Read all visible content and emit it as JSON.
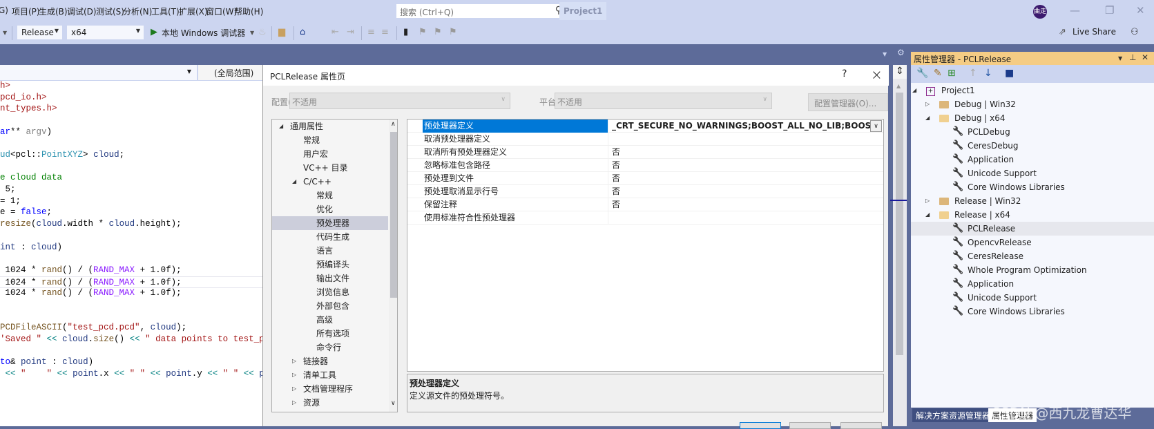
{
  "menubar": {
    "items": [
      "G)",
      "项目(P)",
      "生成(B)",
      "调试(D)",
      "测试(S)",
      "分析(N)",
      "工具(T)",
      "扩展(X)",
      "窗口(W)",
      "帮助(H)"
    ],
    "search_placeholder": "搜索 (Ctrl+Q)",
    "project_name": "Project1",
    "avatar_initials": "曲走"
  },
  "toolbar": {
    "configuration": "Release",
    "platform": "x64",
    "run_label": "本地 Windows 调试器",
    "live_share": "Live Share"
  },
  "editor": {
    "scope": "(全局范围)",
    "lines": [
      [
        [
          "h>",
          "str"
        ]
      ],
      [
        [
          "pcd_io.h>",
          "str"
        ]
      ],
      [
        [
          "nt_types.h>",
          "str"
        ]
      ],
      [],
      [
        [
          "ar",
          "kw"
        ],
        [
          "** ",
          "pl"
        ],
        [
          "argv",
          "par"
        ],
        [
          ")",
          "pl"
        ]
      ],
      [],
      [
        [
          "ud",
          "type"
        ],
        [
          "<pcl::",
          "pl"
        ],
        [
          "PointXYZ",
          "type"
        ],
        [
          "> ",
          "pl"
        ],
        [
          "cloud",
          "var"
        ],
        [
          ";",
          "pl"
        ]
      ],
      [],
      [
        [
          "e cloud data",
          "cm"
        ]
      ],
      [
        [
          " 5;",
          "pl"
        ]
      ],
      [
        [
          "= 1;",
          "pl"
        ]
      ],
      [
        [
          "e = ",
          "pl"
        ],
        [
          "false",
          "kw"
        ],
        [
          ";",
          "pl"
        ]
      ],
      [
        [
          "resize",
          "fn"
        ],
        [
          "(",
          "pl"
        ],
        [
          "cloud",
          "var"
        ],
        [
          ".width * ",
          "pl"
        ],
        [
          "cloud",
          "var"
        ],
        [
          ".height);",
          "pl"
        ]
      ],
      [],
      [
        [
          "int",
          "var"
        ],
        [
          " : ",
          "pl"
        ],
        [
          "cloud",
          "var"
        ],
        [
          ")",
          "pl"
        ]
      ],
      [],
      [
        [
          " 1024 * ",
          "pl"
        ],
        [
          "rand",
          "fn"
        ],
        [
          "() / (",
          "pl"
        ],
        [
          "RAND_MAX",
          "mac"
        ],
        [
          " + 1.0f);",
          "pl"
        ]
      ],
      [
        [
          " 1024 * ",
          "pl"
        ],
        [
          "rand",
          "fn"
        ],
        [
          "() / (",
          "pl"
        ],
        [
          "RAND_MAX",
          "mac"
        ],
        [
          " + 1.0f);",
          "pl"
        ]
      ],
      [
        [
          " 1024 * ",
          "pl"
        ],
        [
          "rand",
          "fn"
        ],
        [
          "() / (",
          "pl"
        ],
        [
          "RAND_MAX",
          "mac"
        ],
        [
          " + 1.0f);",
          "pl"
        ]
      ],
      [],
      [],
      [
        [
          "PCDFileASCII",
          "fn"
        ],
        [
          "(",
          "pl"
        ],
        [
          "\"test_pcd.pcd\"",
          "str"
        ],
        [
          ", ",
          "pl"
        ],
        [
          "cloud",
          "var"
        ],
        [
          ");",
          "pl"
        ]
      ],
      [
        [
          "'Saved \" ",
          "str"
        ],
        [
          "<<",
          "op"
        ],
        [
          " ",
          "pl"
        ],
        [
          "cloud",
          "var"
        ],
        [
          ".",
          "pl"
        ],
        [
          "size",
          "fn"
        ],
        [
          "() ",
          "pl"
        ],
        [
          "<<",
          "op"
        ],
        [
          " \" data points to test_pcd.p",
          "str"
        ]
      ],
      [],
      [
        [
          "to",
          "kw"
        ],
        [
          "& ",
          "pl"
        ],
        [
          "point",
          "var"
        ],
        [
          " : ",
          "pl"
        ],
        [
          "cloud",
          "var"
        ],
        [
          ")",
          "pl"
        ]
      ],
      [
        [
          " ",
          "pl"
        ],
        [
          "<<",
          "op"
        ],
        [
          " \"    \" ",
          "str"
        ],
        [
          "<<",
          "op"
        ],
        [
          " ",
          "pl"
        ],
        [
          "point",
          "var"
        ],
        [
          ".x ",
          "pl"
        ],
        [
          "<<",
          "op"
        ],
        [
          " \" \" ",
          "str"
        ],
        [
          "<<",
          "op"
        ],
        [
          " ",
          "pl"
        ],
        [
          "point",
          "var"
        ],
        [
          ".y ",
          "pl"
        ],
        [
          "<<",
          "op"
        ],
        [
          " \" \" ",
          "str"
        ],
        [
          "<<",
          "op"
        ],
        [
          " ",
          "pl"
        ],
        [
          "point",
          "var"
        ]
      ]
    ],
    "current_line": 17
  },
  "dialog": {
    "title": "PCLRelease 属性页",
    "help": "?",
    "config_label": "配置(C):",
    "config_value": "不适用",
    "platform_label": "平台(P):",
    "platform_value": "不适用",
    "config_manager": "配置管理器(O)...",
    "nav": [
      {
        "label": "通用属性",
        "level": 0,
        "state": "expanded"
      },
      {
        "label": "常规",
        "level": 1
      },
      {
        "label": "用户宏",
        "level": 1
      },
      {
        "label": "VC++ 目录",
        "level": 1
      },
      {
        "label": "C/C++",
        "level": 1,
        "state": "expanded"
      },
      {
        "label": "常规",
        "level": 2
      },
      {
        "label": "优化",
        "level": 2
      },
      {
        "label": "预处理器",
        "level": 2,
        "selected": true
      },
      {
        "label": "代码生成",
        "level": 2
      },
      {
        "label": "语言",
        "level": 2
      },
      {
        "label": "预编译头",
        "level": 2
      },
      {
        "label": "输出文件",
        "level": 2
      },
      {
        "label": "浏览信息",
        "level": 2
      },
      {
        "label": "外部包含",
        "level": 2
      },
      {
        "label": "高级",
        "level": 2
      },
      {
        "label": "所有选项",
        "level": 2
      },
      {
        "label": "命令行",
        "level": 2
      },
      {
        "label": "链接器",
        "level": 1,
        "state": "collapsed"
      },
      {
        "label": "清单工具",
        "level": 1,
        "state": "collapsed"
      },
      {
        "label": "文档管理程序",
        "level": 1,
        "state": "collapsed"
      },
      {
        "label": "资源",
        "level": 1,
        "state": "collapsed"
      }
    ],
    "properties": [
      {
        "name": "预处理器定义",
        "value": "_CRT_SECURE_NO_WARNINGS;BOOST_ALL_NO_LIB;BOOST_USE_",
        "selected": true
      },
      {
        "name": "取消预处理器定义",
        "value": ""
      },
      {
        "name": "取消所有预处理器定义",
        "value": "否"
      },
      {
        "name": "忽略标准包含路径",
        "value": "否"
      },
      {
        "name": "预处理到文件",
        "value": "否"
      },
      {
        "name": "预处理取消显示行号",
        "value": "否"
      },
      {
        "name": "保留注释",
        "value": "否"
      },
      {
        "name": "使用标准符合性预处理器",
        "value": ""
      }
    ],
    "description_title": "预处理器定义",
    "description": "定义源文件的预处理符号。"
  },
  "property_manager": {
    "title": "属性管理器 - PCLRelease",
    "tree": [
      {
        "label": "Project1",
        "level": 0,
        "icon": "project",
        "state": "expanded"
      },
      {
        "label": "Debug | Win32",
        "level": 1,
        "icon": "folder",
        "state": "collapsed"
      },
      {
        "label": "Debug | x64",
        "level": 1,
        "icon": "folder-open",
        "state": "expanded"
      },
      {
        "label": "PCLDebug",
        "level": 2,
        "icon": "wrench"
      },
      {
        "label": "CeresDebug",
        "level": 2,
        "icon": "wrench"
      },
      {
        "label": "Application",
        "level": 2,
        "icon": "wrench"
      },
      {
        "label": "Unicode Support",
        "level": 2,
        "icon": "wrench"
      },
      {
        "label": "Core Windows Libraries",
        "level": 2,
        "icon": "wrench"
      },
      {
        "label": "Release | Win32",
        "level": 1,
        "icon": "folder",
        "state": "collapsed"
      },
      {
        "label": "Release | x64",
        "level": 1,
        "icon": "folder-open",
        "state": "expanded"
      },
      {
        "label": "PCLRelease",
        "level": 2,
        "icon": "wrench",
        "selected": true
      },
      {
        "label": "OpencvRelease",
        "level": 2,
        "icon": "wrench"
      },
      {
        "label": "CeresRelease",
        "level": 2,
        "icon": "wrench"
      },
      {
        "label": "Whole Program Optimization",
        "level": 2,
        "icon": "wrench"
      },
      {
        "label": "Application",
        "level": 2,
        "icon": "wrench"
      },
      {
        "label": "Unicode Support",
        "level": 2,
        "icon": "wrench"
      },
      {
        "label": "Core Windows Libraries",
        "level": 2,
        "icon": "wrench"
      }
    ],
    "tabs": [
      "解决方案资源管理器",
      "属性管理器"
    ],
    "active_tab": 1
  },
  "watermark": "CSDN @西九龙曹达华",
  "colors": {
    "accent": "#0078d7",
    "chrome": "#ccd5f0",
    "band": "#5d6b99",
    "panel_title": "#f5cc84"
  }
}
